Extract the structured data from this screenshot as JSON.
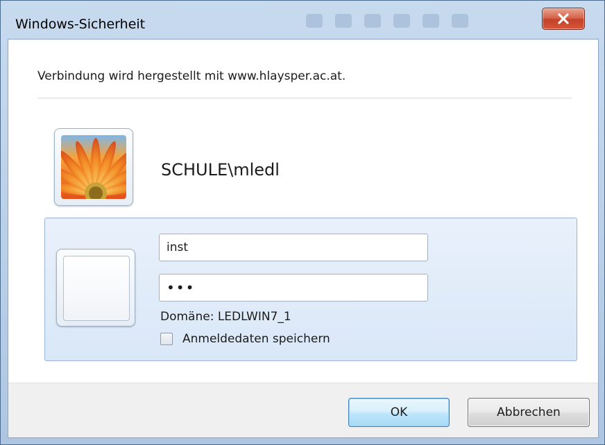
{
  "window": {
    "title": "Windows-Sicherheit",
    "close_icon": "close-icon"
  },
  "message": "Verbindung wird hergestellt mit www.hlaysper.ac.at.",
  "saved_account": {
    "username": "SCHULE\\mledl",
    "avatar_icon": "flower-avatar-icon"
  },
  "credentials": {
    "user_icon": "blank-user-tile-icon",
    "username_value": "inst",
    "password_value": "•••",
    "domain_text": "Domäne: LEDLWIN7_1",
    "remember_label": "Anmeldedaten speichern",
    "remember_checked": false
  },
  "buttons": {
    "ok_label": "OK",
    "cancel_label": "Abbrechen"
  },
  "colors": {
    "panel_bg": "#dce8f7",
    "close_button": "#c9452b",
    "ok_border": "#3c7fb1"
  }
}
